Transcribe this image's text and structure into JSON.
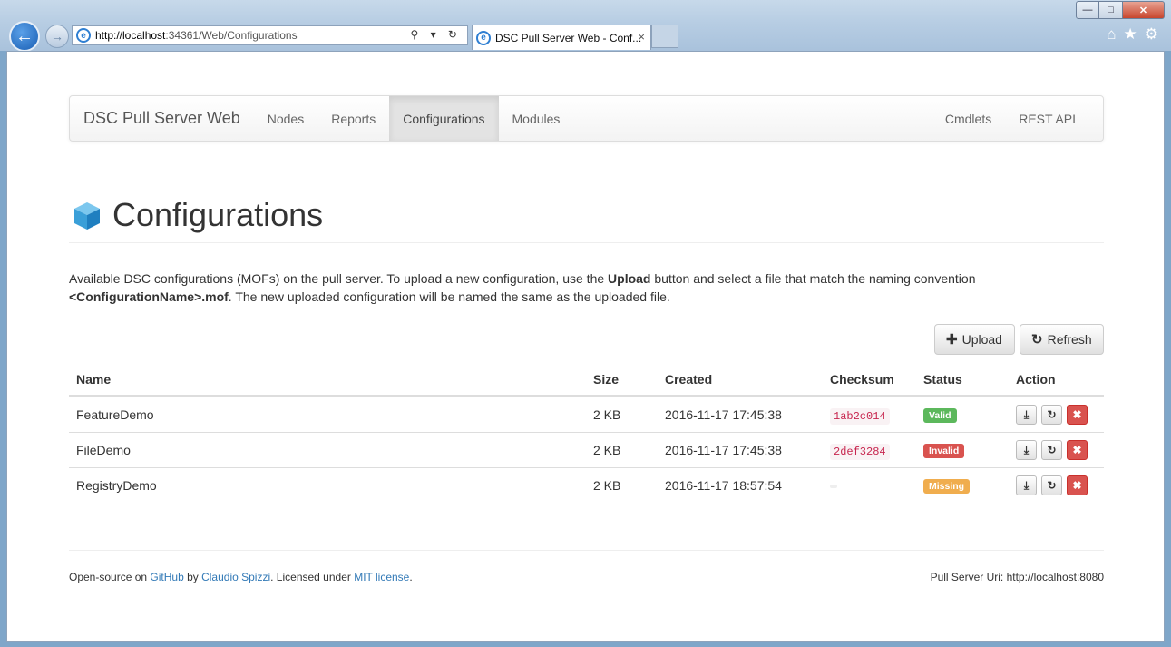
{
  "browser": {
    "url_host": "http://localhost",
    "url_rest": ":34361/Web/Configurations",
    "tab_title": "DSC Pull Server Web - Conf...",
    "tab_close": "×",
    "address_tools": "⚲ ▾ ↻",
    "controls": {
      "minimize": "—",
      "maximize": "□",
      "close": "✕"
    },
    "icons": [
      "home-icon",
      "favorites-star-icon",
      "settings-gear-icon"
    ]
  },
  "navbar": {
    "brand": "DSC Pull Server Web",
    "left_items": [
      "Nodes",
      "Reports",
      "Configurations",
      "Modules"
    ],
    "right_items": [
      "Cmdlets",
      "REST API"
    ],
    "active": "Configurations"
  },
  "page": {
    "title": "Configurations",
    "intro_part1": "Available DSC configurations (MOFs) on the pull server. To upload a new configuration, use the ",
    "intro_bold1": "Upload",
    "intro_part2": " button and select a file that match the naming convention ",
    "intro_bold2": "<ConfigurationName>.mof",
    "intro_part3": ". The new uploaded configuration will be named the same as the uploaded file."
  },
  "buttons": {
    "upload": "Upload",
    "refresh": "Refresh"
  },
  "table": {
    "headers": {
      "name": "Name",
      "size": "Size",
      "created": "Created",
      "checksum": "Checksum",
      "status": "Status",
      "action": "Action"
    },
    "rows": [
      {
        "name": "FeatureDemo",
        "size": "2 KB",
        "created": "2016-11-17 17:45:38",
        "checksum": "1ab2c014",
        "status": "Valid"
      },
      {
        "name": "FileDemo",
        "size": "2 KB",
        "created": "2016-11-17 17:45:38",
        "checksum": "2def3284",
        "status": "Invalid"
      },
      {
        "name": "RegistryDemo",
        "size": "2 KB",
        "created": "2016-11-17 18:57:54",
        "checksum": "",
        "status": "Missing"
      }
    ]
  },
  "footer": {
    "prefix": "Open-source on ",
    "github": "GitHub",
    "by": " by ",
    "author": "Claudio Spizzi",
    "licensed": ". Licensed under ",
    "license": "MIT license",
    "suffix": ".",
    "right": "Pull Server Uri: http://localhost:8080"
  },
  "colors": {
    "valid": "#5cb85c",
    "invalid": "#d9534f",
    "missing": "#f0ad4e",
    "link": "#337ab7"
  }
}
